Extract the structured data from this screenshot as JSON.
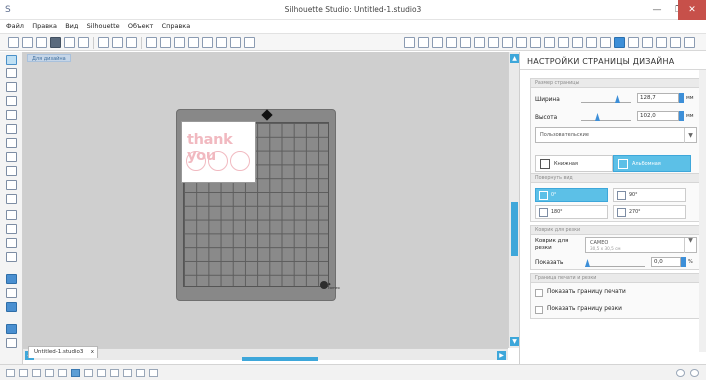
{
  "app": {
    "title": "Silhouette Studio: Untitled-1.studio3"
  },
  "icons": {
    "app": "silhouette-app-icon",
    "minimize": "minimize-icon",
    "maximize": "maximize-icon",
    "close": "close-icon"
  },
  "window": {
    "minimize": "—",
    "maximize": "❐",
    "close": "✕"
  },
  "menu": [
    "Файл",
    "Правка",
    "Вид",
    "Silhouette",
    "Объект",
    "Справка"
  ],
  "canvas": {
    "page_label": "Для дизайна",
    "design_text": "thank you",
    "mat_brand": "◆ cameo",
    "doc_tab": "Untitled-1.studio3",
    "doc_tab_close": "x",
    "accent": "#3ea7da",
    "design_color": "#f1b9c0"
  },
  "panel": {
    "title": "НАСТРОЙКИ СТРАНИЦЫ ДИЗАЙНА",
    "page_size": {
      "header": "Размер страницы",
      "width_label": "Ширина",
      "width_value": "128,7",
      "height_label": "Высота",
      "height_value": "102,0",
      "unit": "мм",
      "preset": "Пользовательские",
      "orient_portrait": "Книжная",
      "orient_landscape": "Альбомная",
      "orientation_selected": "Альбомная"
    },
    "rotate": {
      "header": "Повернуть вид",
      "r0": "0°",
      "r90": "90°",
      "r180": "180°",
      "r270": "270°",
      "selected": "0°"
    },
    "mat": {
      "header": "Коврик для резки",
      "label": "Коврик для резки",
      "value_line1": "CAMEO",
      "value_line2": "30,5 x 30,5 см",
      "show_label": "Показать",
      "show_value": "0,0",
      "show_unit": "%"
    },
    "borders": {
      "header": "Граница печати и резки",
      "print_border": "Показать границу печати",
      "cut_border": "Показать границу резки",
      "print_checked": false,
      "cut_checked": false
    }
  }
}
